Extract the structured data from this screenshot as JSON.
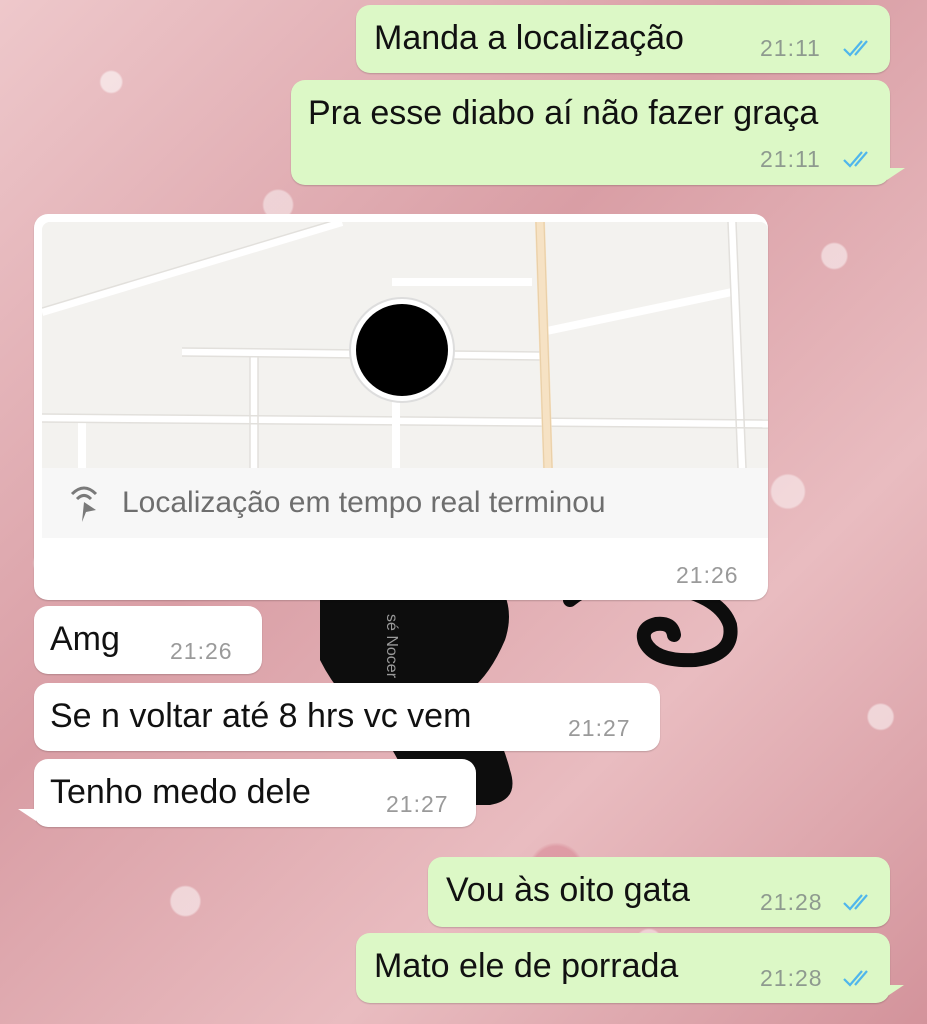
{
  "chat": {
    "messages": [
      {
        "id": "m1",
        "direction": "outgoing",
        "text": "Manda a localização",
        "time": "21:11",
        "status": "read"
      },
      {
        "id": "m2",
        "direction": "outgoing",
        "text": "Pra esse diabo aí não fazer graça",
        "time": "21:11",
        "status": "read"
      },
      {
        "id": "m3",
        "direction": "incoming",
        "type": "live-location",
        "street_label": "sé Nocer",
        "label": "Localização em tempo real terminou",
        "time": "21:26"
      },
      {
        "id": "m4",
        "direction": "incoming",
        "text": "Amg",
        "time": "21:26"
      },
      {
        "id": "m5",
        "direction": "incoming",
        "text": "Se n voltar até 8 hrs vc vem",
        "time": "21:27"
      },
      {
        "id": "m6",
        "direction": "incoming",
        "text": "Tenho medo dele",
        "time": "21:27"
      },
      {
        "id": "m7",
        "direction": "outgoing",
        "text": "Vou às oito gata",
        "time": "21:28",
        "status": "read"
      },
      {
        "id": "m8",
        "direction": "outgoing",
        "text": "Mato ele de porrada",
        "time": "21:28",
        "status": "read"
      }
    ]
  },
  "colors": {
    "outgoing_bubble": "#dcf8c6",
    "incoming_bubble": "#ffffff",
    "read_ticks": "#4fb6ec"
  },
  "icons": {
    "read_receipt": "double-check-icon",
    "live_location": "live-location-icon",
    "map_pin": "avatar-pin"
  }
}
